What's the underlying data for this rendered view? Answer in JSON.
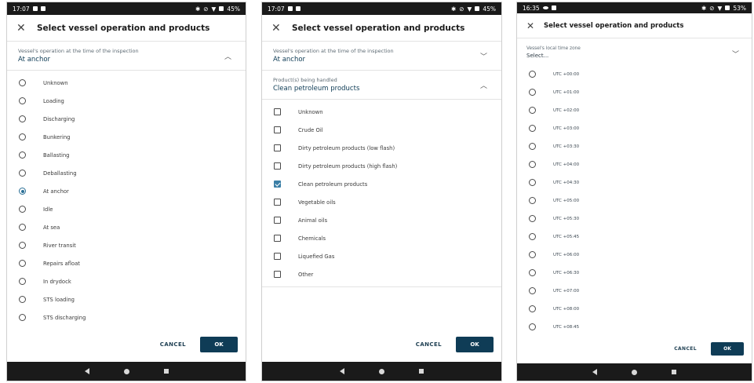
{
  "screens": [
    {
      "status": {
        "time": "17:07",
        "battery": "45%"
      },
      "title": "Select vessel operation and products",
      "section": {
        "label": "Vessel's operation at the time of the inspection",
        "value": "At anchor",
        "chevron": "up"
      },
      "options": [
        {
          "label": "Unknown",
          "checked": false
        },
        {
          "label": "Loading",
          "checked": false
        },
        {
          "label": "Discharging",
          "checked": false
        },
        {
          "label": "Bunkering",
          "checked": false
        },
        {
          "label": "Ballasting",
          "checked": false
        },
        {
          "label": "Deballasting",
          "checked": false
        },
        {
          "label": "At anchor",
          "checked": true
        },
        {
          "label": "Idle",
          "checked": false
        },
        {
          "label": "At sea",
          "checked": false
        },
        {
          "label": "River transit",
          "checked": false
        },
        {
          "label": "Repairs afloat",
          "checked": false
        },
        {
          "label": "In drydock",
          "checked": false
        },
        {
          "label": "STS loading",
          "checked": false
        },
        {
          "label": "STS discharging",
          "checked": false
        }
      ],
      "cancel": "CANCEL",
      "ok": "OK"
    },
    {
      "status": {
        "time": "17:07",
        "battery": "45%"
      },
      "title": "Select vessel operation and products",
      "section_collapsed": {
        "label": "Vessel's operation at the time of the inspection",
        "value": "At anchor",
        "chevron": "down"
      },
      "section": {
        "label": "Product(s) being handled",
        "value": "Clean petroleum products",
        "chevron": "up"
      },
      "options": [
        {
          "label": "Unknown",
          "checked": false
        },
        {
          "label": "Crude Oil",
          "checked": false
        },
        {
          "label": "Dirty petroleum products (low flash)",
          "checked": false
        },
        {
          "label": "Dirty petroleum products (high flash)",
          "checked": false
        },
        {
          "label": "Clean petroleum products",
          "checked": true
        },
        {
          "label": "Vegetable oils",
          "checked": false
        },
        {
          "label": "Animal oils",
          "checked": false
        },
        {
          "label": "Chemicals",
          "checked": false
        },
        {
          "label": "Liquefied Gas",
          "checked": false
        },
        {
          "label": "Other",
          "checked": false
        }
      ],
      "cancel": "CANCEL",
      "ok": "OK"
    },
    {
      "status": {
        "time": "16:35",
        "battery": "53%"
      },
      "title": "Select vessel operation and products",
      "section": {
        "label": "Vessel's local time zone",
        "value": "Select...",
        "chevron": "down"
      },
      "options": [
        {
          "label": "UTC +00:00",
          "checked": false
        },
        {
          "label": "UTC +01:00",
          "checked": false
        },
        {
          "label": "UTC +02:00",
          "checked": false
        },
        {
          "label": "UTC +03:00",
          "checked": false
        },
        {
          "label": "UTC +03:30",
          "checked": false
        },
        {
          "label": "UTC +04:00",
          "checked": false
        },
        {
          "label": "UTC +04:30",
          "checked": false
        },
        {
          "label": "UTC +05:00",
          "checked": false
        },
        {
          "label": "UTC +05:30",
          "checked": false
        },
        {
          "label": "UTC +05:45",
          "checked": false
        },
        {
          "label": "UTC +06:00",
          "checked": false
        },
        {
          "label": "UTC +06:30",
          "checked": false
        },
        {
          "label": "UTC +07:00",
          "checked": false
        },
        {
          "label": "UTC +08:00",
          "checked": false
        },
        {
          "label": "UTC +08:45",
          "checked": false
        }
      ],
      "cancel": "CANCEL",
      "ok": "OK"
    }
  ],
  "colors": {
    "accent": "#0f3c56",
    "checked": "#3b7fa6",
    "bars": "#1a1a1a"
  }
}
